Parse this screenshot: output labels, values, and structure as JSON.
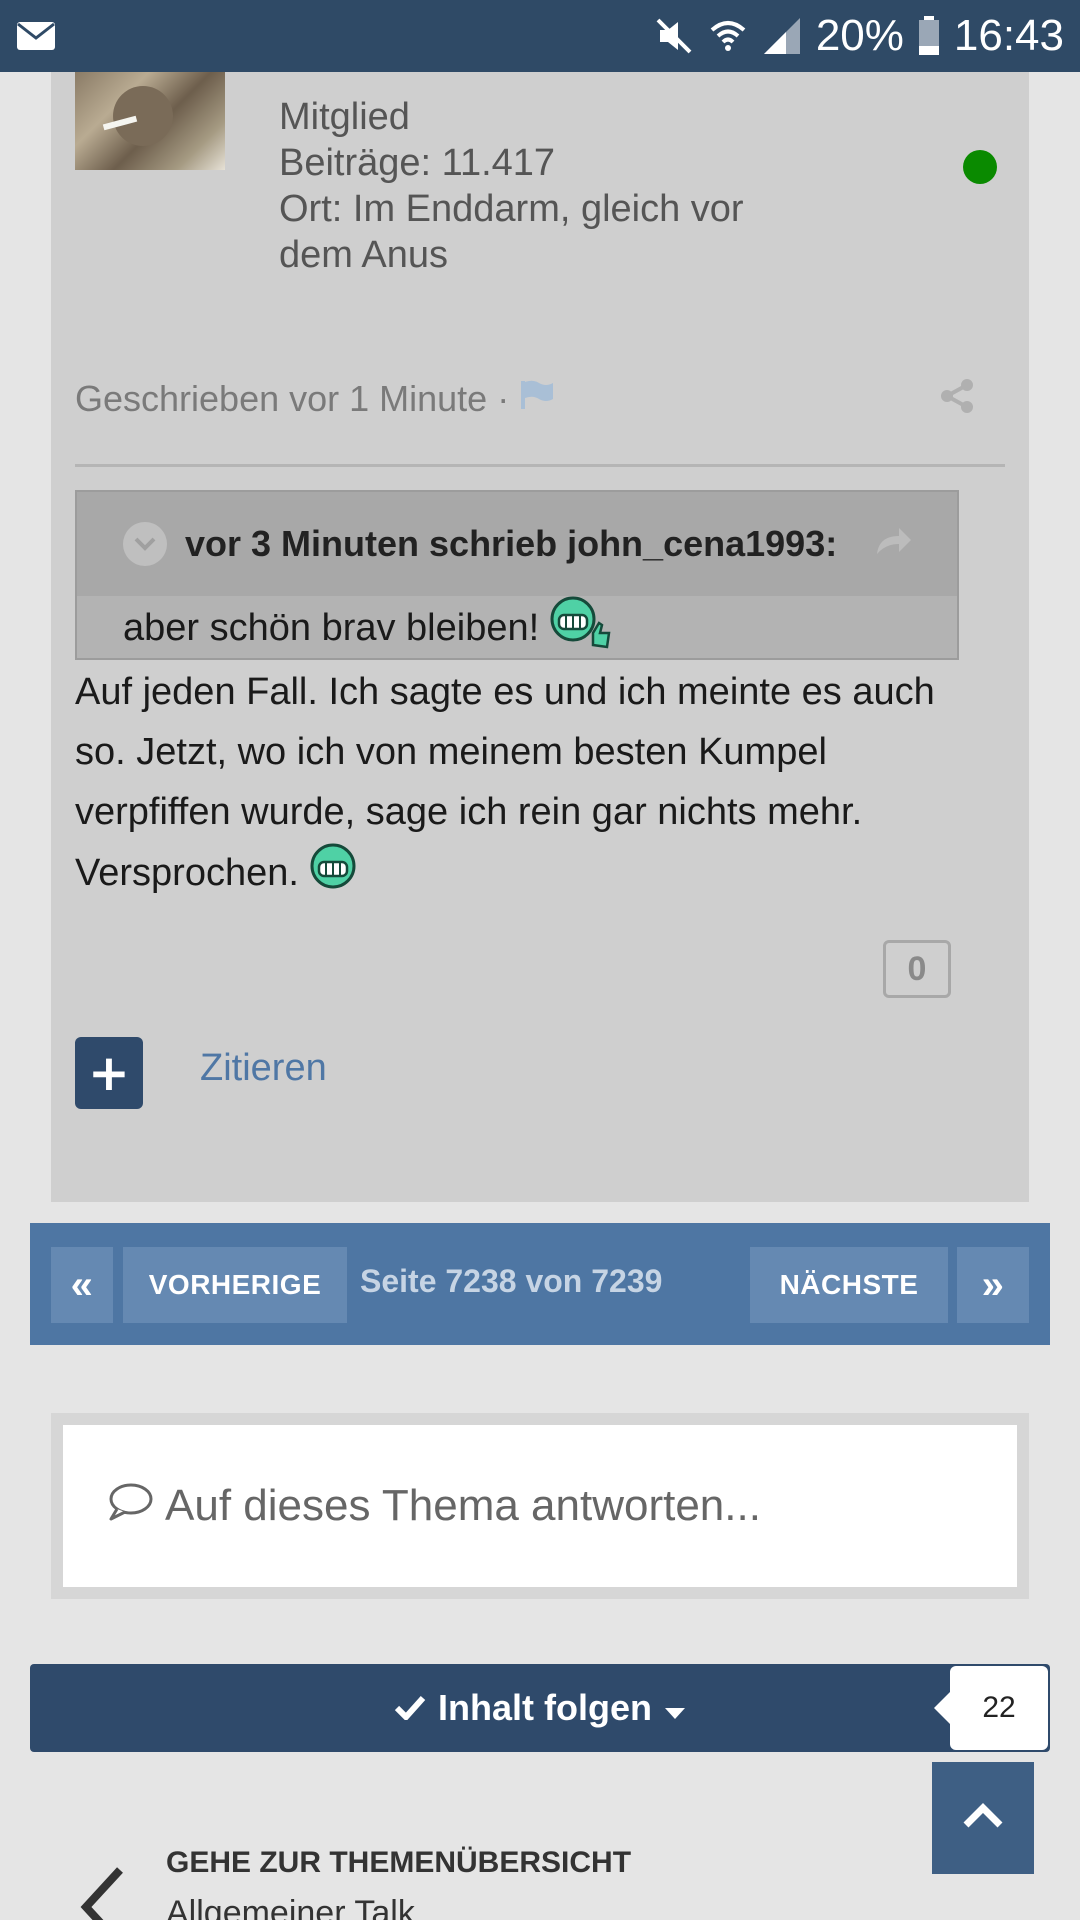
{
  "status_bar": {
    "battery_percent": "20%",
    "time": "16:43",
    "icons": [
      "mail-icon",
      "mute-icon",
      "wifi-icon",
      "signal-icon",
      "battery-icon"
    ]
  },
  "post": {
    "author_rank": "Mitglied",
    "posts_count": "Beiträge: 11.417",
    "location_line1": "Ort: Im Enddarm, gleich vor",
    "location_line2": "dem Anus",
    "online_color": "#0a8a00",
    "written": "Geschrieben vor 1 Minute ·",
    "quote": {
      "header": "vor 3 Minuten schrieb john_cena1993:",
      "body": "aber schön brav bleiben!"
    },
    "text_lines": [
      "Auf jeden Fall. Ich sagte es und ich meinte es auch",
      "so. Jetzt, wo ich von meinem besten Kumpel",
      "verpfiffen wurde, sage ich rein gar nichts mehr.",
      "Versprochen."
    ],
    "reputation": "0",
    "multiquote_label": "+",
    "quote_link": "Zitieren"
  },
  "pagination": {
    "first": "«",
    "prev": "VORHERIGE",
    "info": "Seite 7238 von 7239",
    "next": "NÄCHSTE",
    "last": "»"
  },
  "reply": {
    "placeholder": "Auf dieses Thema antworten..."
  },
  "follow": {
    "label": "Inhalt folgen",
    "count": "22"
  },
  "navigation": {
    "goto_label": "GEHE ZUR THEMENÜBERSICHT",
    "forum_name": "Allgemeiner Talk"
  },
  "colors": {
    "header": "#2f4a66",
    "pagination": "#4e76a3",
    "follow": "#2f4a6b",
    "link": "#4f77a5"
  }
}
